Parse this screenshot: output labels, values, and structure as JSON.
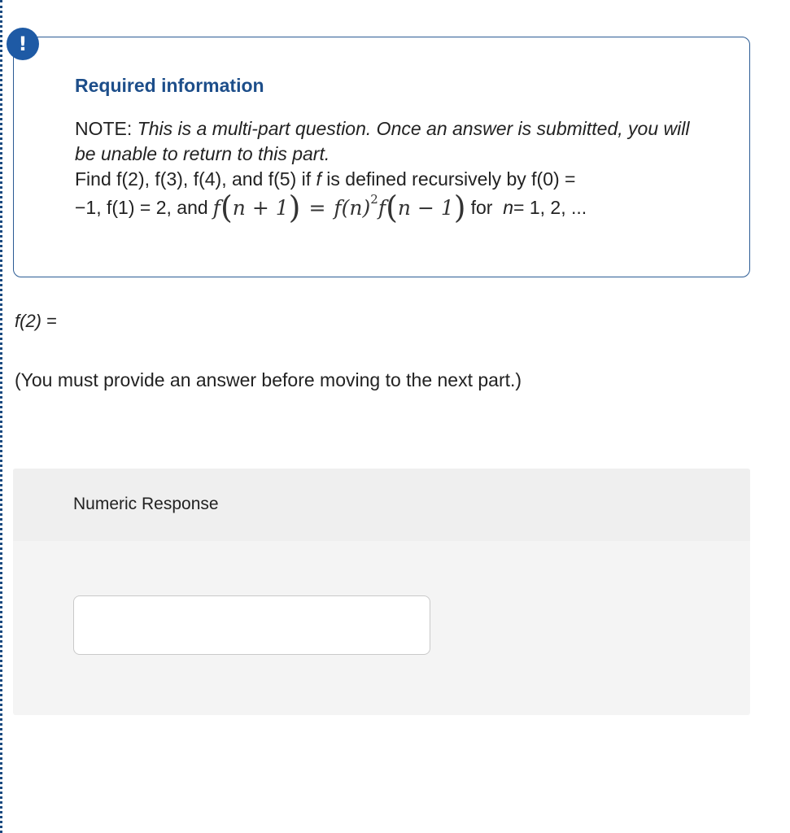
{
  "alert": {
    "icon": "exclamation-icon",
    "symbol": "!"
  },
  "info": {
    "title": "Required information",
    "note_label": "NOTE: ",
    "note_italic": "This is a multi-part question. Once an answer is submitted, you will be unable to return to this part.",
    "find_prefix": "Find f(2), f(3), f(4), and f(5) if ",
    "find_var": "f",
    "find_mid": " is defined recursively by f(0) =",
    "line3_start": "−1, f(1) = 2, and",
    "formula": {
      "lhs_f": "f",
      "lhs_arg": "n + 1",
      "eq": "=",
      "rhs_fn": "f(n)",
      "rhs_exp": "2",
      "rhs_f": "f",
      "rhs_arg": "n − 1"
    },
    "for_text": "for",
    "n_var": "n",
    "n_values": " = 1, 2, ..."
  },
  "answer": {
    "label_fn": "f(2)",
    "label_eq": " ="
  },
  "must_text": "(You must provide an answer before moving to the next part.)",
  "response": {
    "title": "Numeric Response",
    "value": "",
    "placeholder": ""
  },
  "colors": {
    "accent": "#1e5aa5",
    "title": "#1d4e8a",
    "border": "#2b5b94",
    "panel": "#f4f4f4"
  }
}
